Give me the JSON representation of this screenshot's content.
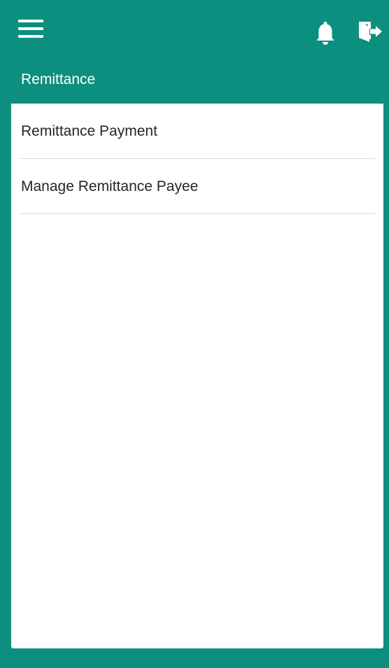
{
  "topbar": {
    "menu_icon": "hamburger-menu-icon",
    "notification_icon": "bell-icon",
    "logout_icon": "logout-door-icon",
    "background_color": "#0d8f7f"
  },
  "panel": {
    "title": "Remittance",
    "items": [
      {
        "label": "Remittance Payment"
      },
      {
        "label": "Manage Remittance Payee"
      }
    ]
  }
}
